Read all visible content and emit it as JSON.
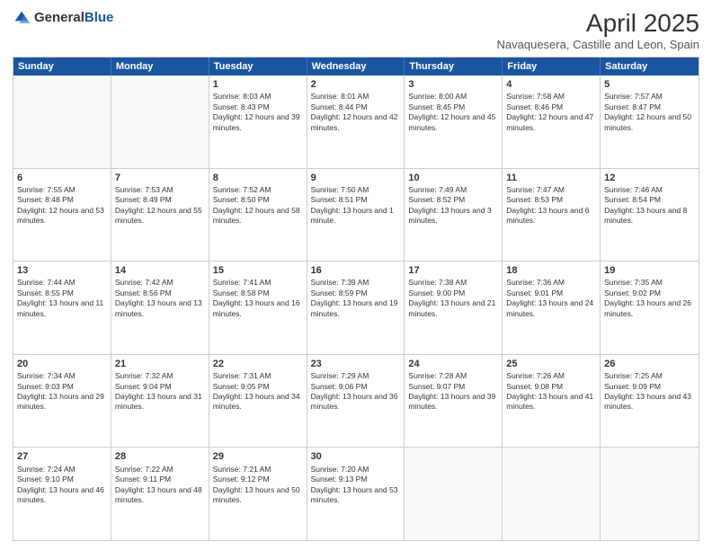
{
  "header": {
    "logo_general": "General",
    "logo_blue": "Blue",
    "month_title": "April 2025",
    "location": "Navaquesera, Castille and Leon, Spain"
  },
  "weekdays": [
    "Sunday",
    "Monday",
    "Tuesday",
    "Wednesday",
    "Thursday",
    "Friday",
    "Saturday"
  ],
  "rows": [
    [
      {
        "day": "",
        "text": ""
      },
      {
        "day": "",
        "text": ""
      },
      {
        "day": "1",
        "text": "Sunrise: 8:03 AM\nSunset: 8:43 PM\nDaylight: 12 hours and 39 minutes."
      },
      {
        "day": "2",
        "text": "Sunrise: 8:01 AM\nSunset: 8:44 PM\nDaylight: 12 hours and 42 minutes."
      },
      {
        "day": "3",
        "text": "Sunrise: 8:00 AM\nSunset: 8:45 PM\nDaylight: 12 hours and 45 minutes."
      },
      {
        "day": "4",
        "text": "Sunrise: 7:58 AM\nSunset: 8:46 PM\nDaylight: 12 hours and 47 minutes."
      },
      {
        "day": "5",
        "text": "Sunrise: 7:57 AM\nSunset: 8:47 PM\nDaylight: 12 hours and 50 minutes."
      }
    ],
    [
      {
        "day": "6",
        "text": "Sunrise: 7:55 AM\nSunset: 8:48 PM\nDaylight: 12 hours and 53 minutes."
      },
      {
        "day": "7",
        "text": "Sunrise: 7:53 AM\nSunset: 8:49 PM\nDaylight: 12 hours and 55 minutes."
      },
      {
        "day": "8",
        "text": "Sunrise: 7:52 AM\nSunset: 8:50 PM\nDaylight: 12 hours and 58 minutes."
      },
      {
        "day": "9",
        "text": "Sunrise: 7:50 AM\nSunset: 8:51 PM\nDaylight: 13 hours and 1 minute."
      },
      {
        "day": "10",
        "text": "Sunrise: 7:49 AM\nSunset: 8:52 PM\nDaylight: 13 hours and 3 minutes."
      },
      {
        "day": "11",
        "text": "Sunrise: 7:47 AM\nSunset: 8:53 PM\nDaylight: 13 hours and 6 minutes."
      },
      {
        "day": "12",
        "text": "Sunrise: 7:46 AM\nSunset: 8:54 PM\nDaylight: 13 hours and 8 minutes."
      }
    ],
    [
      {
        "day": "13",
        "text": "Sunrise: 7:44 AM\nSunset: 8:55 PM\nDaylight: 13 hours and 11 minutes."
      },
      {
        "day": "14",
        "text": "Sunrise: 7:42 AM\nSunset: 8:56 PM\nDaylight: 13 hours and 13 minutes."
      },
      {
        "day": "15",
        "text": "Sunrise: 7:41 AM\nSunset: 8:58 PM\nDaylight: 13 hours and 16 minutes."
      },
      {
        "day": "16",
        "text": "Sunrise: 7:39 AM\nSunset: 8:59 PM\nDaylight: 13 hours and 19 minutes."
      },
      {
        "day": "17",
        "text": "Sunrise: 7:38 AM\nSunset: 9:00 PM\nDaylight: 13 hours and 21 minutes."
      },
      {
        "day": "18",
        "text": "Sunrise: 7:36 AM\nSunset: 9:01 PM\nDaylight: 13 hours and 24 minutes."
      },
      {
        "day": "19",
        "text": "Sunrise: 7:35 AM\nSunset: 9:02 PM\nDaylight: 13 hours and 26 minutes."
      }
    ],
    [
      {
        "day": "20",
        "text": "Sunrise: 7:34 AM\nSunset: 9:03 PM\nDaylight: 13 hours and 29 minutes."
      },
      {
        "day": "21",
        "text": "Sunrise: 7:32 AM\nSunset: 9:04 PM\nDaylight: 13 hours and 31 minutes."
      },
      {
        "day": "22",
        "text": "Sunrise: 7:31 AM\nSunset: 9:05 PM\nDaylight: 13 hours and 34 minutes."
      },
      {
        "day": "23",
        "text": "Sunrise: 7:29 AM\nSunset: 9:06 PM\nDaylight: 13 hours and 36 minutes."
      },
      {
        "day": "24",
        "text": "Sunrise: 7:28 AM\nSunset: 9:07 PM\nDaylight: 13 hours and 39 minutes."
      },
      {
        "day": "25",
        "text": "Sunrise: 7:26 AM\nSunset: 9:08 PM\nDaylight: 13 hours and 41 minutes."
      },
      {
        "day": "26",
        "text": "Sunrise: 7:25 AM\nSunset: 9:09 PM\nDaylight: 13 hours and 43 minutes."
      }
    ],
    [
      {
        "day": "27",
        "text": "Sunrise: 7:24 AM\nSunset: 9:10 PM\nDaylight: 13 hours and 46 minutes."
      },
      {
        "day": "28",
        "text": "Sunrise: 7:22 AM\nSunset: 9:11 PM\nDaylight: 13 hours and 48 minutes."
      },
      {
        "day": "29",
        "text": "Sunrise: 7:21 AM\nSunset: 9:12 PM\nDaylight: 13 hours and 50 minutes."
      },
      {
        "day": "30",
        "text": "Sunrise: 7:20 AM\nSunset: 9:13 PM\nDaylight: 13 hours and 53 minutes."
      },
      {
        "day": "",
        "text": ""
      },
      {
        "day": "",
        "text": ""
      },
      {
        "day": "",
        "text": ""
      }
    ]
  ]
}
